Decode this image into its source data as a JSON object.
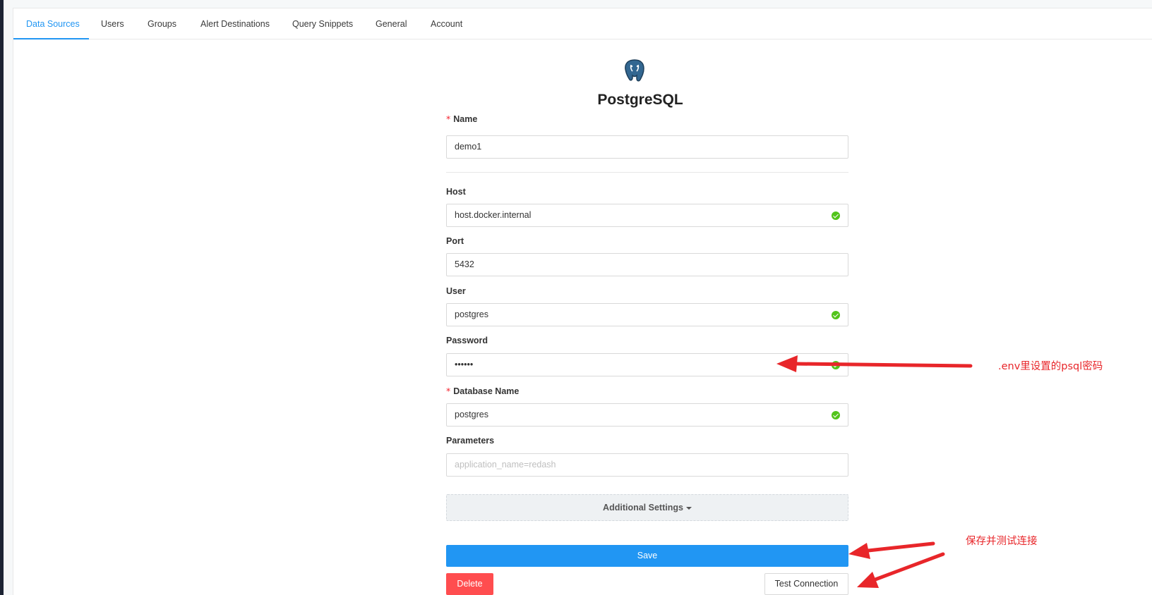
{
  "tabs": [
    {
      "label": "Data Sources",
      "active": true
    },
    {
      "label": "Users",
      "active": false
    },
    {
      "label": "Groups",
      "active": false
    },
    {
      "label": "Alert Destinations",
      "active": false
    },
    {
      "label": "Query Snippets",
      "active": false
    },
    {
      "label": "General",
      "active": false
    },
    {
      "label": "Account",
      "active": false
    }
  ],
  "data_source": {
    "logo_icon": "postgresql-elephant-icon",
    "title": "PostgreSQL"
  },
  "form": {
    "name": {
      "label": "Name",
      "required": true,
      "value": "demo1"
    },
    "host": {
      "label": "Host",
      "value": "host.docker.internal",
      "valid": true
    },
    "port": {
      "label": "Port",
      "value": "5432"
    },
    "user": {
      "label": "User",
      "value": "postgres",
      "valid": true
    },
    "password": {
      "label": "Password",
      "value": "••••••",
      "valid": true
    },
    "database_name": {
      "label": "Database Name",
      "required": true,
      "value": "postgres",
      "valid": true
    },
    "parameters": {
      "label": "Parameters",
      "value": "",
      "placeholder": "application_name=redash"
    },
    "additional_settings": "Additional Settings",
    "required_marker": "*"
  },
  "buttons": {
    "save": "Save",
    "delete": "Delete",
    "test_connection": "Test Connection"
  },
  "annotations": {
    "password_note": ".env里设置的psql密码",
    "save_note": "保存并测试连接",
    "color": "#e8262a"
  },
  "colors": {
    "accent": "#2196f3",
    "danger": "#ff4d4f",
    "success": "#52c41a"
  }
}
